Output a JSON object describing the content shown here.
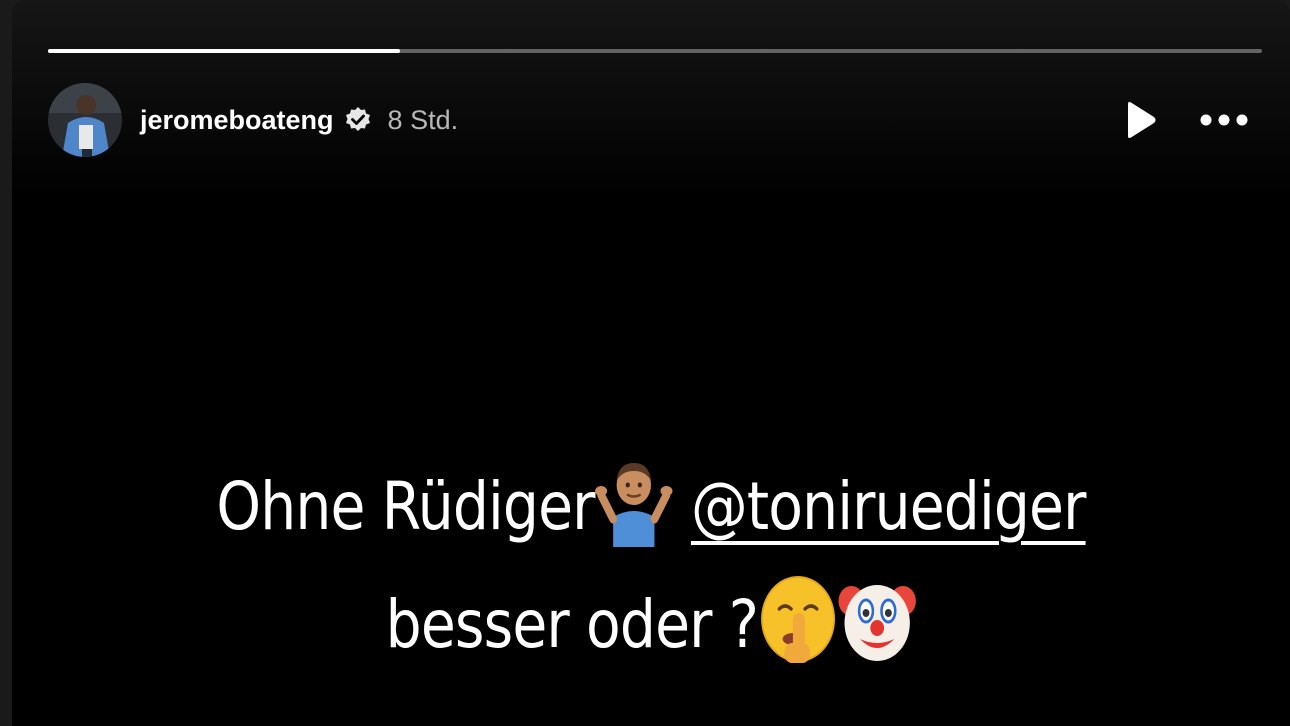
{
  "story": {
    "progress": 0.29,
    "username": "jeromeboateng",
    "verified": true,
    "timestamp": "8 Std.",
    "controls": {
      "play_icon": "play-icon",
      "more_icon": "more-options-icon"
    },
    "caption": {
      "line1_text": "Ohne Rüdiger",
      "line1_emoji": "person-shrugging-emoji",
      "mention": "@toniruediger",
      "line2_text": "besser oder ?",
      "line2_emojis": [
        "shushing-face-emoji",
        "clown-face-emoji"
      ]
    }
  },
  "colors": {
    "background": "#000000",
    "text": "#ffffff",
    "timestamp": "#b8b8b8",
    "progress_track": "rgba(255,255,255,0.35)",
    "progress_fill": "#ffffff"
  }
}
